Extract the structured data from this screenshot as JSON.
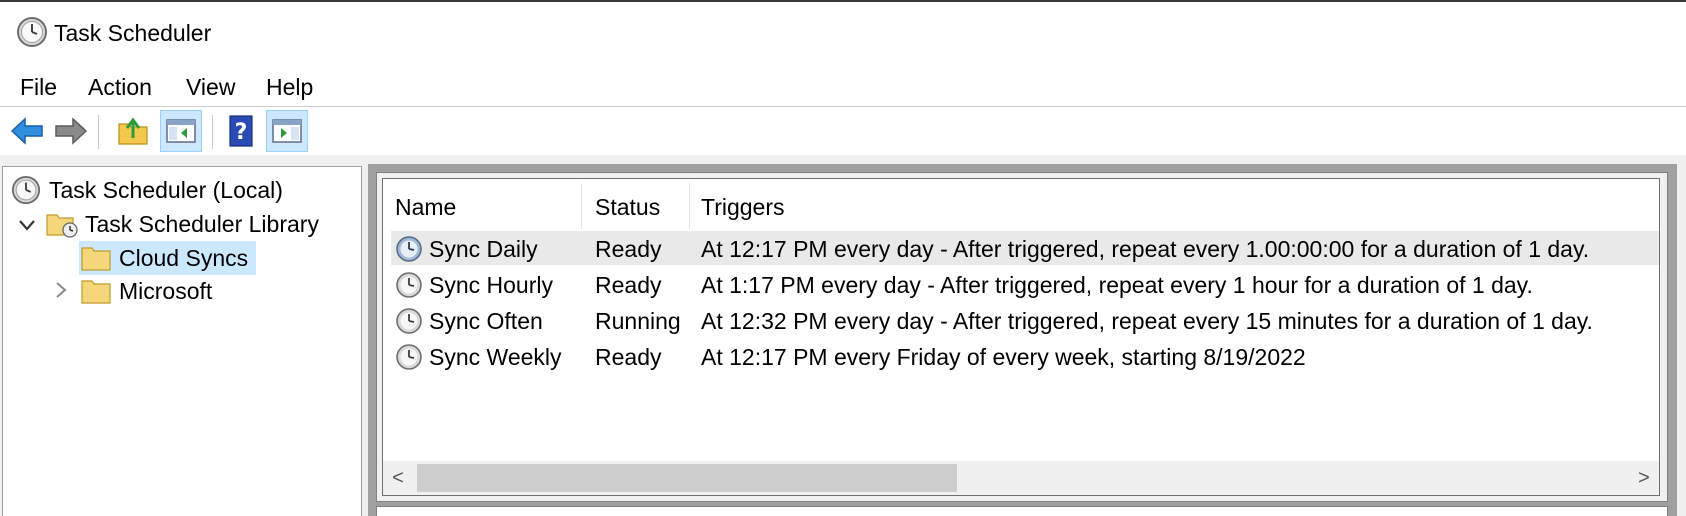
{
  "window": {
    "title": "Task Scheduler"
  },
  "menu": {
    "items": [
      "File",
      "Action",
      "View",
      "Help"
    ]
  },
  "tree": {
    "root": "Task Scheduler (Local)",
    "library": "Task Scheduler Library",
    "folders": [
      {
        "label": "Cloud Syncs",
        "selected": true
      },
      {
        "label": "Microsoft",
        "selected": false
      }
    ]
  },
  "task_list": {
    "columns": [
      "Name",
      "Status",
      "Triggers"
    ],
    "rows": [
      {
        "name": "Sync Daily",
        "status": "Ready",
        "triggers": "At 12:17 PM every day - After triggered, repeat every 1.00:00:00 for a duration of 1 day."
      },
      {
        "name": "Sync Hourly",
        "status": "Ready",
        "triggers": "At 1:17 PM every day - After triggered, repeat every 1 hour for a duration of 1 day."
      },
      {
        "name": "Sync Often",
        "status": "Running",
        "triggers": "At 12:32 PM every day - After triggered, repeat every 15 minutes for a duration of 1 day."
      },
      {
        "name": "Sync Weekly",
        "status": "Ready",
        "triggers": "At 12:17 PM every Friday of every week, starting 8/19/2022"
      }
    ]
  },
  "scrollbar": {
    "left_arrow": "<",
    "right_arrow": ">"
  },
  "colors": {
    "selection": "#cce8ff",
    "row_highlight": "#e9e9e9",
    "pane_bg": "#f0f0f0"
  },
  "icons": {
    "app": "clock-icon",
    "back": "back-arrow-icon",
    "forward": "forward-arrow-icon",
    "up_folder": "up-folder-icon",
    "show_hide_console_tree": "console-tree-icon",
    "help": "help-icon",
    "show_hide_action_pane": "action-pane-icon",
    "folder": "folder-icon",
    "task": "task-clock-icon"
  }
}
